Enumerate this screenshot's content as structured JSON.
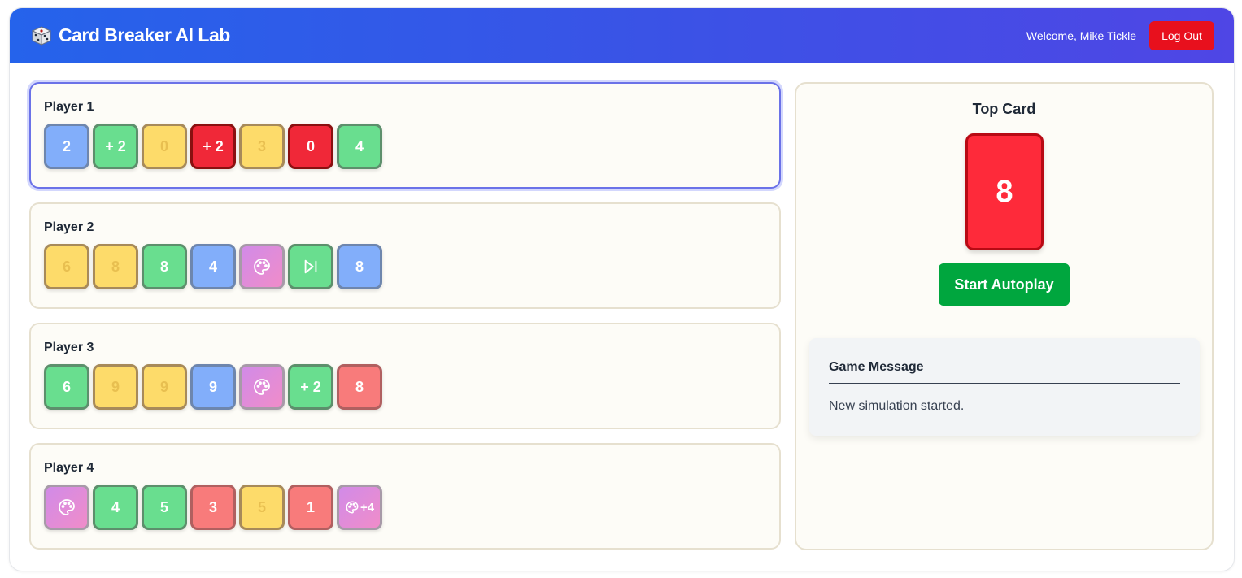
{
  "header": {
    "title": "Card Breaker AI Lab",
    "icon": "dice-icon",
    "welcome": "Welcome, Mike Tickle",
    "logout_label": "Log Out"
  },
  "players": [
    {
      "name": "Player 1",
      "active": true,
      "cards": [
        {
          "label": "2",
          "color": "blue"
        },
        {
          "label": "+ 2",
          "color": "green"
        },
        {
          "label": "0",
          "color": "yellow"
        },
        {
          "label": "+ 2",
          "color": "red"
        },
        {
          "label": "3",
          "color": "yellow"
        },
        {
          "label": "0",
          "color": "red"
        },
        {
          "label": "4",
          "color": "green"
        }
      ]
    },
    {
      "name": "Player 2",
      "active": false,
      "cards": [
        {
          "label": "6",
          "color": "yellow"
        },
        {
          "label": "8",
          "color": "yellow"
        },
        {
          "label": "8",
          "color": "green"
        },
        {
          "label": "4",
          "color": "blue"
        },
        {
          "label": "",
          "color": "wild",
          "icon": "palette-icon"
        },
        {
          "label": "",
          "color": "green",
          "icon": "skip-icon"
        },
        {
          "label": "8",
          "color": "blue"
        }
      ]
    },
    {
      "name": "Player 3",
      "active": false,
      "cards": [
        {
          "label": "6",
          "color": "green"
        },
        {
          "label": "9",
          "color": "yellow"
        },
        {
          "label": "9",
          "color": "yellow"
        },
        {
          "label": "9",
          "color": "blue"
        },
        {
          "label": "",
          "color": "wild",
          "icon": "palette-icon"
        },
        {
          "label": "+ 2",
          "color": "green"
        },
        {
          "label": "8",
          "color": "red"
        }
      ]
    },
    {
      "name": "Player 4",
      "active": false,
      "cards": [
        {
          "label": "",
          "color": "wild",
          "icon": "palette-icon"
        },
        {
          "label": "4",
          "color": "green"
        },
        {
          "label": "5",
          "color": "green"
        },
        {
          "label": "3",
          "color": "red"
        },
        {
          "label": "5",
          "color": "yellow"
        },
        {
          "label": "1",
          "color": "red"
        },
        {
          "label": "+4",
          "color": "wild",
          "icon": "palette-icon"
        }
      ]
    }
  ],
  "top_card": {
    "title": "Top Card",
    "value": "8",
    "color": "red"
  },
  "autoplay_label": "Start Autoplay",
  "game_message": {
    "title": "Game Message",
    "text": "New simulation started."
  },
  "colors": {
    "header_start": "#2563eb",
    "header_end": "#4f46e5",
    "logout": "#e8101d",
    "autoplay": "#00a63e",
    "top_card": "#fe2a3a"
  }
}
